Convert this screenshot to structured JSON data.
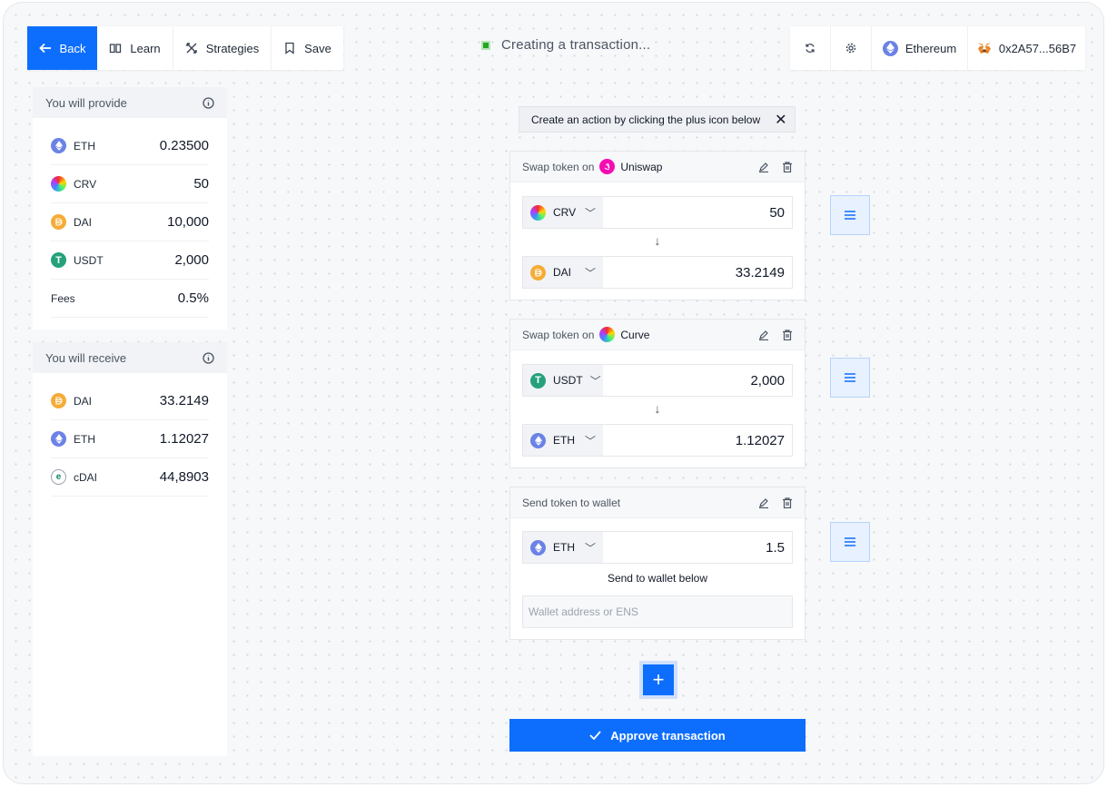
{
  "toolbar": {
    "back_label": "Back",
    "learn_label": "Learn",
    "strategies_label": "Strategies",
    "save_label": "Save"
  },
  "status": {
    "text": "Creating a transaction..."
  },
  "network": {
    "name": "Ethereum",
    "wallet": "0x2A57...56B7"
  },
  "provide": {
    "title": "You will provide",
    "rows": [
      {
        "token": "ETH",
        "value": "0.23500"
      },
      {
        "token": "CRV",
        "value": "50"
      },
      {
        "token": "DAI",
        "value": "10,000"
      },
      {
        "token": "USDT",
        "value": "2,000"
      },
      {
        "token": "Fees",
        "value": "0.5%"
      }
    ]
  },
  "receive": {
    "title": "You will receive",
    "rows": [
      {
        "token": "DAI",
        "value": "33.2149"
      },
      {
        "token": "ETH",
        "value": "1.12027"
      },
      {
        "token": "cDAI",
        "value": "44,8903"
      }
    ]
  },
  "hint": {
    "text": "Create an action by clicking the plus icon below"
  },
  "actions": [
    {
      "title": "Swap token on",
      "protocol": "Uniswap",
      "from_token": "CRV",
      "from_value": "50",
      "to_token": "DAI",
      "to_value": "33.2149"
    },
    {
      "title": "Swap token on",
      "protocol": "Curve",
      "from_token": "USDT",
      "from_value": "2,000",
      "to_token": "ETH",
      "to_value": "1.12027"
    },
    {
      "title": "Send token to wallet",
      "token": "ETH",
      "value": "1.5",
      "send_label": "Send to wallet below",
      "wallet_placeholder": "Wallet address or ENS"
    }
  ],
  "approve": {
    "label": "Approve transaction"
  },
  "colors": {
    "primary": "#0d6efd",
    "status": "#22a722"
  }
}
